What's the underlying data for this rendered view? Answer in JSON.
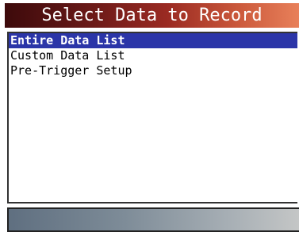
{
  "header": {
    "title": "Select Data to Record"
  },
  "menu": {
    "items": [
      {
        "label": "Entire Data List",
        "selected": true
      },
      {
        "label": "Custom Data List",
        "selected": false
      },
      {
        "label": "Pre-Trigger Setup",
        "selected": false
      }
    ]
  },
  "status_bar": {
    "text": ""
  },
  "colors": {
    "title_gradient_start": "#3d0a0b",
    "title_gradient_end": "#e8805a",
    "selection_highlight": "#2b35a8",
    "status_gradient_start": "#5f6f80",
    "status_gradient_end": "#c4c6c6"
  }
}
